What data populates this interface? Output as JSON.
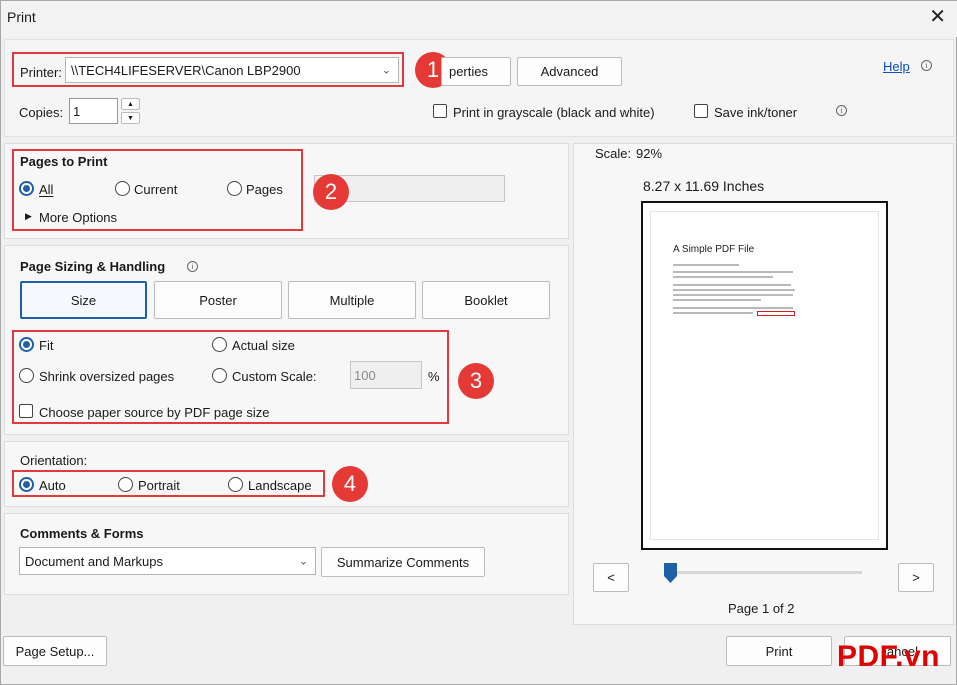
{
  "window": {
    "title": "Print",
    "close_glyph": "✕"
  },
  "printer": {
    "label": "Printer:",
    "selected": "\\\\TECH4LIFESERVER\\Canon LBP2900",
    "properties_label": "perties",
    "advanced_label": "Advanced",
    "help_label": "Help"
  },
  "copies": {
    "label": "Copies:",
    "value": "1"
  },
  "options": {
    "grayscale_label": "Print in grayscale (black and white)",
    "grayscale_checked": false,
    "save_ink_label": "Save ink/toner",
    "save_ink_checked": false
  },
  "pages_to_print": {
    "heading": "Pages to Print",
    "all_label": "All",
    "current_label": "Current",
    "pages_label": "Pages",
    "selected": "All",
    "pages_value": "",
    "more_options_label": "More Options"
  },
  "page_sizing": {
    "heading": "Page Sizing & Handling",
    "tabs": [
      "Size",
      "Poster",
      "Multiple",
      "Booklet"
    ],
    "active_tab": "Size",
    "fit_label": "Fit",
    "actual_size_label": "Actual size",
    "shrink_label": "Shrink oversized pages",
    "custom_scale_label": "Custom Scale:",
    "custom_scale_value": "100",
    "percent_label": "%",
    "selected": "Fit",
    "paper_source_label": "Choose paper source by PDF page size",
    "paper_source_checked": false
  },
  "orientation": {
    "heading": "Orientation:",
    "auto_label": "Auto",
    "portrait_label": "Portrait",
    "landscape_label": "Landscape",
    "selected": "Auto"
  },
  "comments_forms": {
    "heading": "Comments & Forms",
    "selected": "Document and Markups",
    "summarize_label": "Summarize Comments"
  },
  "preview": {
    "scale_label": "Scale:",
    "scale_value": "92%",
    "paper_size": "8.27 x 11.69 Inches",
    "doc_title": "A Simple PDF File",
    "prev_glyph": "<",
    "next_glyph": ">",
    "page_indicator": "Page 1 of 2",
    "page_position": 0
  },
  "footer": {
    "page_setup_label": "Page Setup...",
    "print_label": "Print",
    "cancel_label": "ancel"
  },
  "markers": [
    "1",
    "2",
    "3",
    "4"
  ],
  "watermark": "PDF.vn",
  "colors": {
    "accent": "#1f5fa8",
    "marker": "#e53935",
    "highlight_box": "#e0393e",
    "link": "#0b4fc2",
    "watermark": "#e00000"
  }
}
